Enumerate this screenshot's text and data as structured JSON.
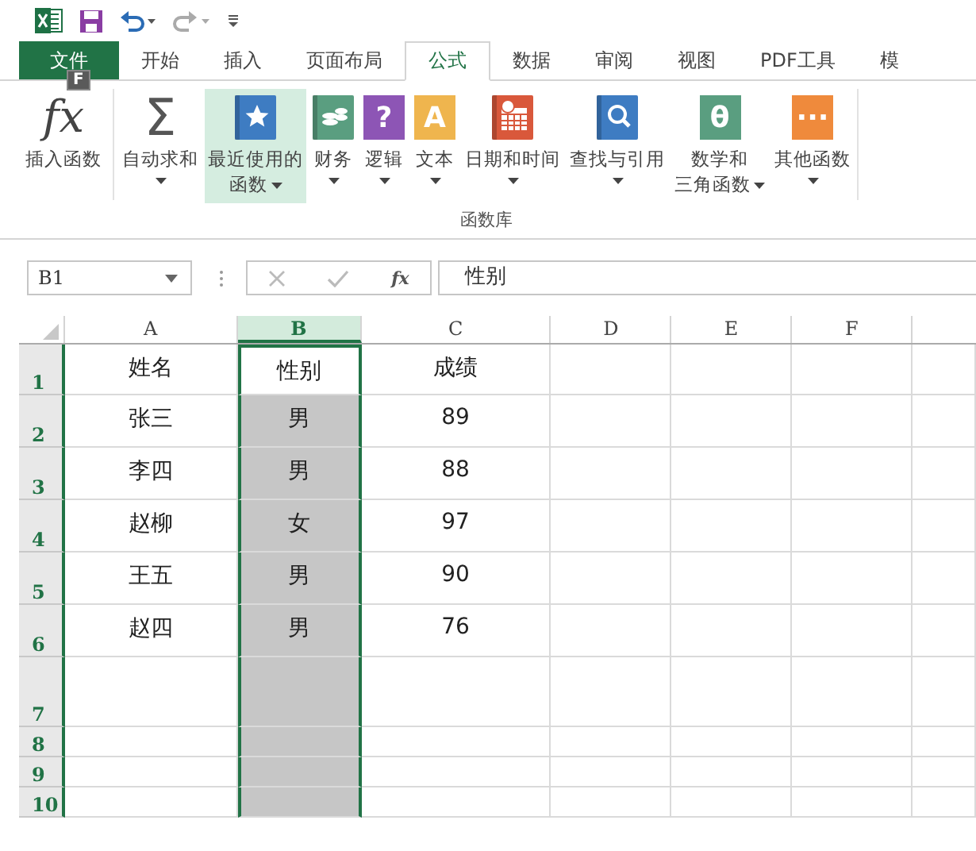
{
  "tabs": [
    {
      "label": "文件",
      "kind": "file",
      "selected": false,
      "keytip": "F"
    },
    {
      "label": "开始",
      "kind": "tab",
      "selected": false
    },
    {
      "label": "插入",
      "kind": "tab",
      "selected": false
    },
    {
      "label": "页面布局",
      "kind": "tab",
      "selected": false
    },
    {
      "label": "公式",
      "kind": "tab",
      "selected": true
    },
    {
      "label": "数据",
      "kind": "tab",
      "selected": false
    },
    {
      "label": "审阅",
      "kind": "tab",
      "selected": false
    },
    {
      "label": "视图",
      "kind": "tab",
      "selected": false
    },
    {
      "label": "PDF工具",
      "kind": "tab",
      "selected": false
    },
    {
      "label": "模",
      "kind": "tab",
      "selected": false
    }
  ],
  "ribbon": {
    "insert_function": {
      "glyph": "fx",
      "lines": [
        "插入函数"
      ]
    },
    "group_label": "函数库",
    "items": [
      {
        "kind": "sum",
        "glyph": "Σ",
        "lines": [
          "自动求和"
        ],
        "caret": true,
        "selected": false
      },
      {
        "kind": "star",
        "color": "#3e7cc2",
        "lines": [
          "最近使用的",
          "函数"
        ],
        "caret": true,
        "selected": true
      },
      {
        "kind": "coins",
        "color": "#5a9e80",
        "lines": [
          "财务"
        ],
        "caret": true,
        "selected": false
      },
      {
        "kind": "glyph",
        "glyph": "?",
        "color": "#8d55b5",
        "lines": [
          "逻辑"
        ],
        "caret": true,
        "selected": false
      },
      {
        "kind": "glyph",
        "glyph": "A",
        "color": "#efb54e",
        "lines": [
          "文本"
        ],
        "caret": true,
        "selected": false
      },
      {
        "kind": "calendar",
        "color": "#d9583b",
        "lines": [
          "日期和时间"
        ],
        "caret": true,
        "selected": false
      },
      {
        "kind": "search",
        "color": "#3e7cc2",
        "lines": [
          "查找与引用"
        ],
        "caret": true,
        "selected": false
      },
      {
        "kind": "glyph",
        "glyph": "θ",
        "color": "#5a9e80",
        "lines": [
          "数学和",
          "三角函数"
        ],
        "caret": true,
        "selected": false
      },
      {
        "kind": "glyph",
        "glyph": "···",
        "color": "#ef8a3c",
        "lines": [
          "其他函数"
        ],
        "caret": true,
        "selected": false
      }
    ]
  },
  "formula_bar": {
    "name_box": "B1",
    "function_button": "fx",
    "value": "性别"
  },
  "columns": [
    {
      "label": "A",
      "selected": false
    },
    {
      "label": "B",
      "selected": true
    },
    {
      "label": "C",
      "selected": false
    },
    {
      "label": "D",
      "selected": false
    },
    {
      "label": "E",
      "selected": false
    },
    {
      "label": "F",
      "selected": false
    }
  ],
  "rows": [
    {
      "number": "1",
      "cells": [
        "姓名",
        "性别",
        "成绩"
      ]
    },
    {
      "number": "2",
      "cells": [
        "张三",
        "男",
        "89"
      ]
    },
    {
      "number": "3",
      "cells": [
        "李四",
        "男",
        "88"
      ]
    },
    {
      "number": "4",
      "cells": [
        "赵柳",
        "女",
        "97"
      ]
    },
    {
      "number": "5",
      "cells": [
        "王五",
        "男",
        "90"
      ]
    },
    {
      "number": "6",
      "cells": [
        "赵四",
        "男",
        "76"
      ]
    },
    {
      "number": "7",
      "cells": []
    },
    {
      "number": "8",
      "cells": []
    },
    {
      "number": "9",
      "cells": []
    },
    {
      "number": "10",
      "cells": []
    }
  ]
}
